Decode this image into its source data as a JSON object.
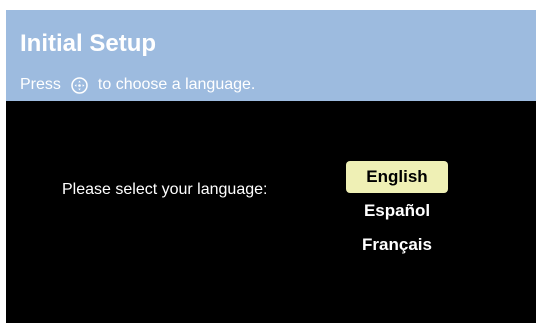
{
  "header": {
    "title": "Initial Setup",
    "hint_before": "Press",
    "hint_icon": "ok-button-icon",
    "hint_after": "to choose a language."
  },
  "main": {
    "prompt": "Please select your language:",
    "languages": [
      {
        "label": "English",
        "selected": true
      },
      {
        "label": "Español",
        "selected": false
      },
      {
        "label": "Français",
        "selected": false
      }
    ]
  },
  "colors": {
    "header_bg": "#9dbbdf",
    "screen_bg": "#000000",
    "selected_bg": "#eff0b5",
    "text": "#ffffff"
  }
}
